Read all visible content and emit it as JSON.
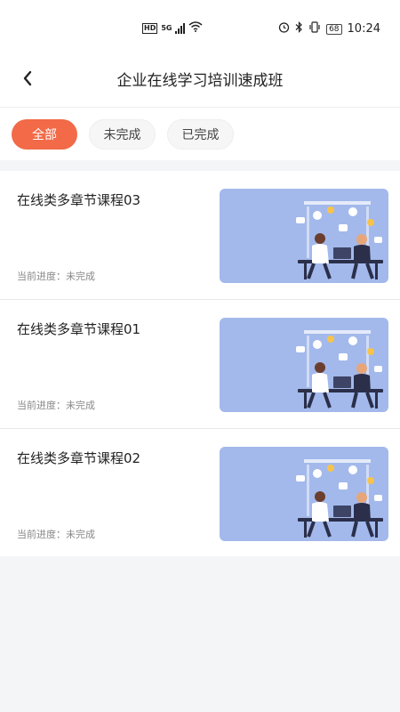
{
  "status_bar": {
    "network_badge": "HD",
    "network_gen": "5G",
    "battery": "68",
    "time": "10:24"
  },
  "header": {
    "title": "企业在线学习培训速成班",
    "back_icon": "chevron-left-icon"
  },
  "tabs": [
    {
      "label": "全部",
      "active": true
    },
    {
      "label": "未完成",
      "active": false
    },
    {
      "label": "已完成",
      "active": false
    }
  ],
  "courses": [
    {
      "title": "在线类多章节课程03",
      "progress_label": "当前进度：",
      "progress_value": "未完成"
    },
    {
      "title": "在线类多章节课程01",
      "progress_label": "当前进度：",
      "progress_value": "未完成"
    },
    {
      "title": "在线类多章节课程02",
      "progress_label": "当前进度：",
      "progress_value": "未完成"
    }
  ],
  "colors": {
    "accent": "#f26a48",
    "thumb_bg": "#a3b9eb"
  }
}
